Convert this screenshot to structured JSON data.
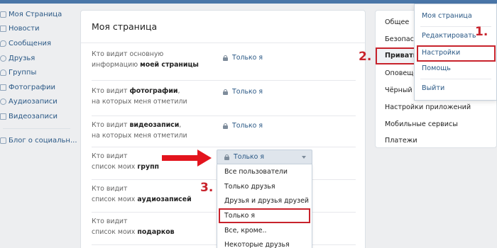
{
  "sidebar": {
    "items": [
      {
        "label": "Моя Страница",
        "icon": "home-icon"
      },
      {
        "label": "Новости",
        "icon": "news-icon"
      },
      {
        "label": "Сообщения",
        "icon": "messages-icon"
      },
      {
        "label": "Друзья",
        "icon": "friends-icon"
      },
      {
        "label": "Группы",
        "icon": "groups-icon"
      },
      {
        "label": "Фотографии",
        "icon": "photos-icon"
      },
      {
        "label": "Аудиозаписи",
        "icon": "audio-icon"
      },
      {
        "label": "Видеозаписи",
        "icon": "video-icon"
      }
    ],
    "blog": {
      "label": "Блог о социальн...",
      "icon": "blog-icon"
    }
  },
  "main": {
    "title": "Моя страница",
    "rows": [
      {
        "line1": "Кто видит основную",
        "line2_pre": "информацию ",
        "line2_bold": "моей страницы",
        "value": "Только я"
      },
      {
        "line1_pre": "Кто видит ",
        "line1_bold": "фотографии",
        "line1_post": ",",
        "line2": "на которых меня отметили",
        "value": "Только я"
      },
      {
        "line1_pre": "Кто видит ",
        "line1_bold": "видеозаписи",
        "line1_post": ",",
        "line2": "на которых меня отметили",
        "value": "Только я"
      },
      {
        "line1": "Кто видит",
        "line2_pre": "список моих ",
        "line2_bold": "групп"
      },
      {
        "line1": "Кто видит",
        "line2_pre": "список моих ",
        "line2_bold": "аудиозаписей"
      },
      {
        "line1": "Кто видит",
        "line2_pre": "список моих ",
        "line2_bold": "подарков"
      }
    ]
  },
  "dropdown": {
    "selected": "Только я",
    "options": [
      "Все пользователи",
      "Только друзья",
      "Друзья и друзья друзей",
      "Только я",
      "Все, кроме..",
      "Некоторые друзья"
    ],
    "highlighted_index": 3
  },
  "settings_menu": {
    "items": [
      "Общее",
      "Безопасн",
      "Приватно",
      "Оповещен",
      "Чёрный с",
      "Настройки приложений",
      "Мобильные сервисы",
      "Платежи"
    ],
    "active_index": 2
  },
  "account_menu": {
    "items": [
      "Моя страница",
      "Редактировать",
      "Настройки",
      "Помощь",
      "Выйти"
    ],
    "highlighted_index": 2
  },
  "annotations": {
    "step1": "1.",
    "step2": "2.",
    "step3": "3."
  },
  "colors": {
    "accent": "#4a76a8",
    "link": "#2a5885",
    "highlight": "#c8232c"
  }
}
